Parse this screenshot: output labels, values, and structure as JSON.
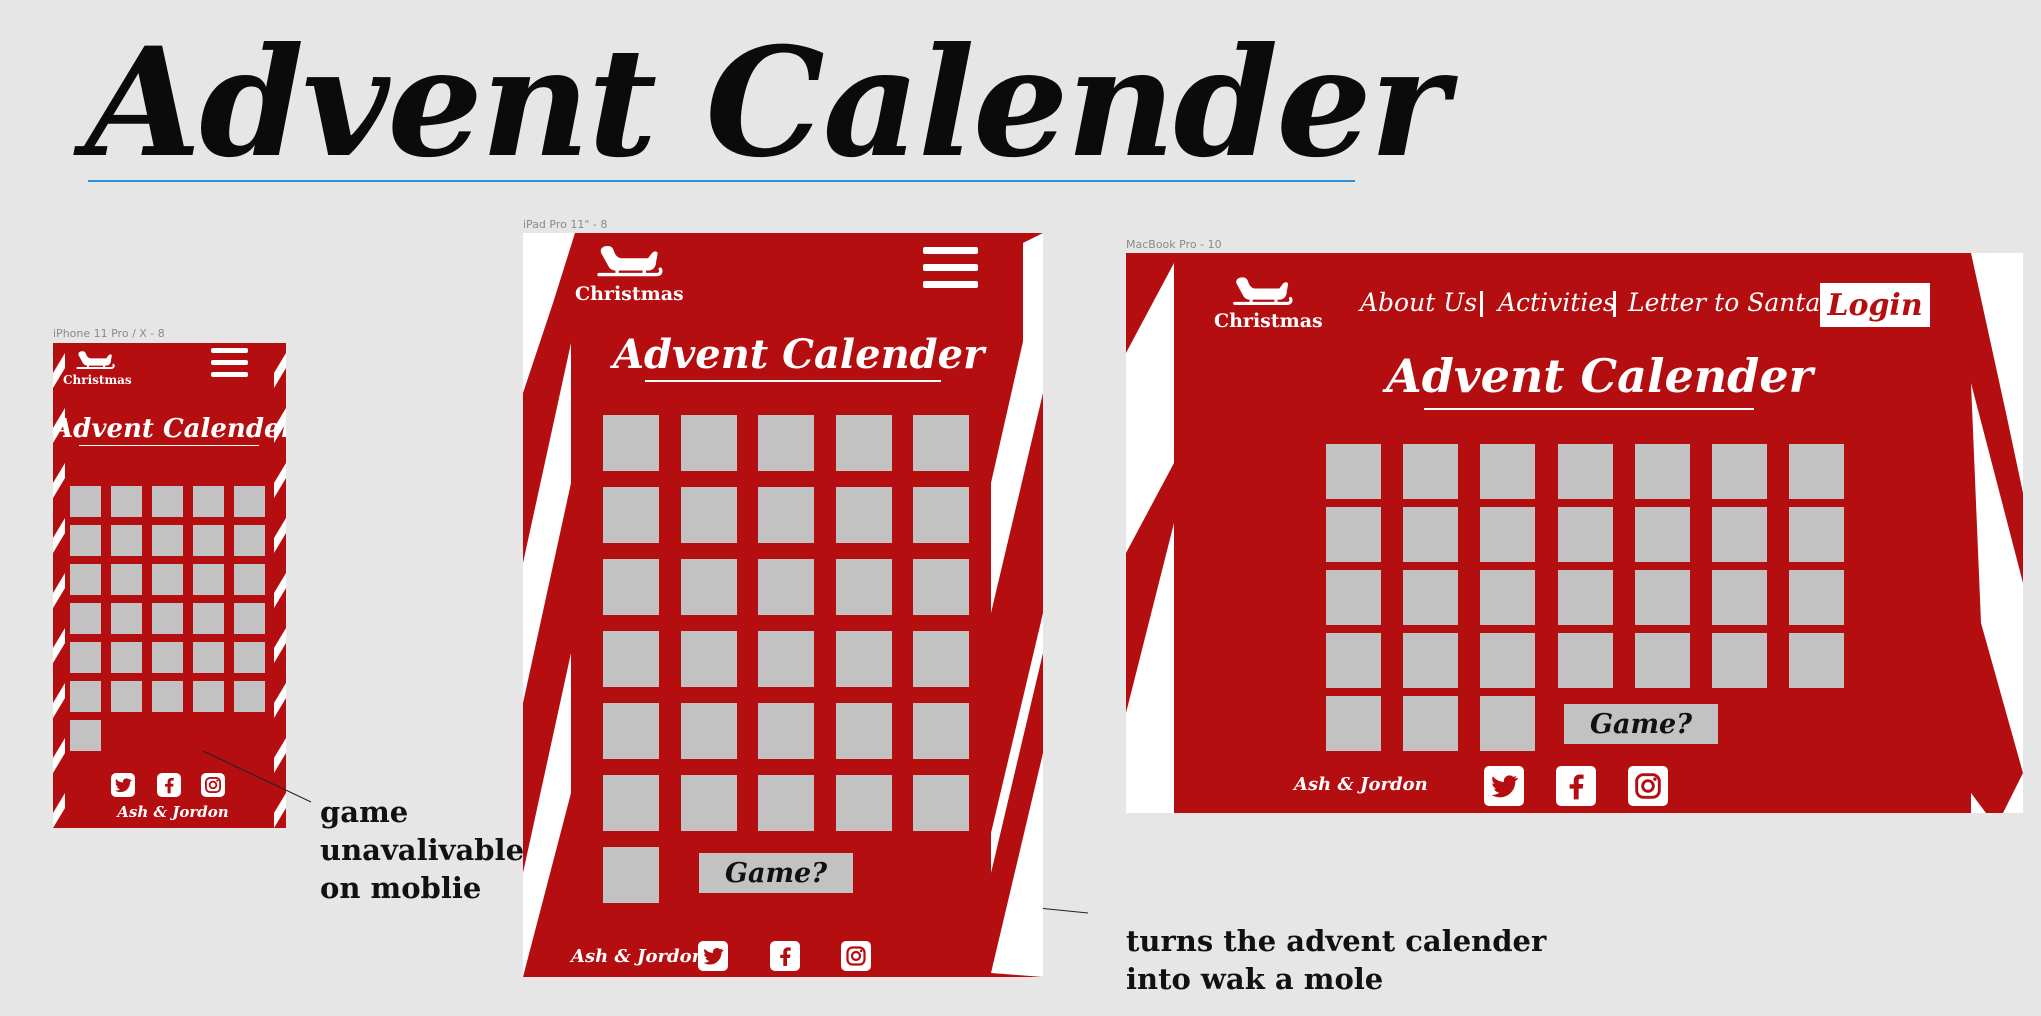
{
  "page": {
    "title": "Advent Calender",
    "colors": {
      "background": "#e6e6e6",
      "brand_red": "#b50e11",
      "tile_gray": "#c2c2c2",
      "guide_line": "#2d8fd6"
    }
  },
  "frames": {
    "phone": {
      "label": "iPhone 11 Pro / X - 8",
      "logo_text": "Christmas",
      "heading": "Advent Calender",
      "menu_icon": "hamburger-icon",
      "footer_name": "Ash & Jordon",
      "social": [
        "twitter-icon",
        "facebook-icon",
        "instagram-icon"
      ],
      "tile_count": 31
    },
    "tablet": {
      "label": "iPad Pro 11\" - 8",
      "logo_text": "Christmas",
      "heading": "Advent Calender",
      "menu_icon": "hamburger-icon",
      "game_label": "Game?",
      "footer_name": "Ash & Jordon",
      "social": [
        "twitter-icon",
        "facebook-icon",
        "instagram-icon"
      ],
      "tile_count": 31
    },
    "desktop": {
      "label": "MacBook Pro - 10",
      "logo_text": "Christmas",
      "nav": [
        "About Us",
        "Activities",
        "Letter to Santa"
      ],
      "login_label": "Login",
      "heading": "Advent Calender",
      "game_label": "Game?",
      "footer_name": "Ash & Jordon",
      "social": [
        "twitter-icon",
        "facebook-icon",
        "instagram-icon"
      ],
      "tile_count": 31
    }
  },
  "annotations": {
    "mobile_note": [
      "game",
      "unavalivable",
      "on moblie"
    ],
    "game_note": [
      "turns the advent calender",
      "into wak a mole"
    ]
  }
}
